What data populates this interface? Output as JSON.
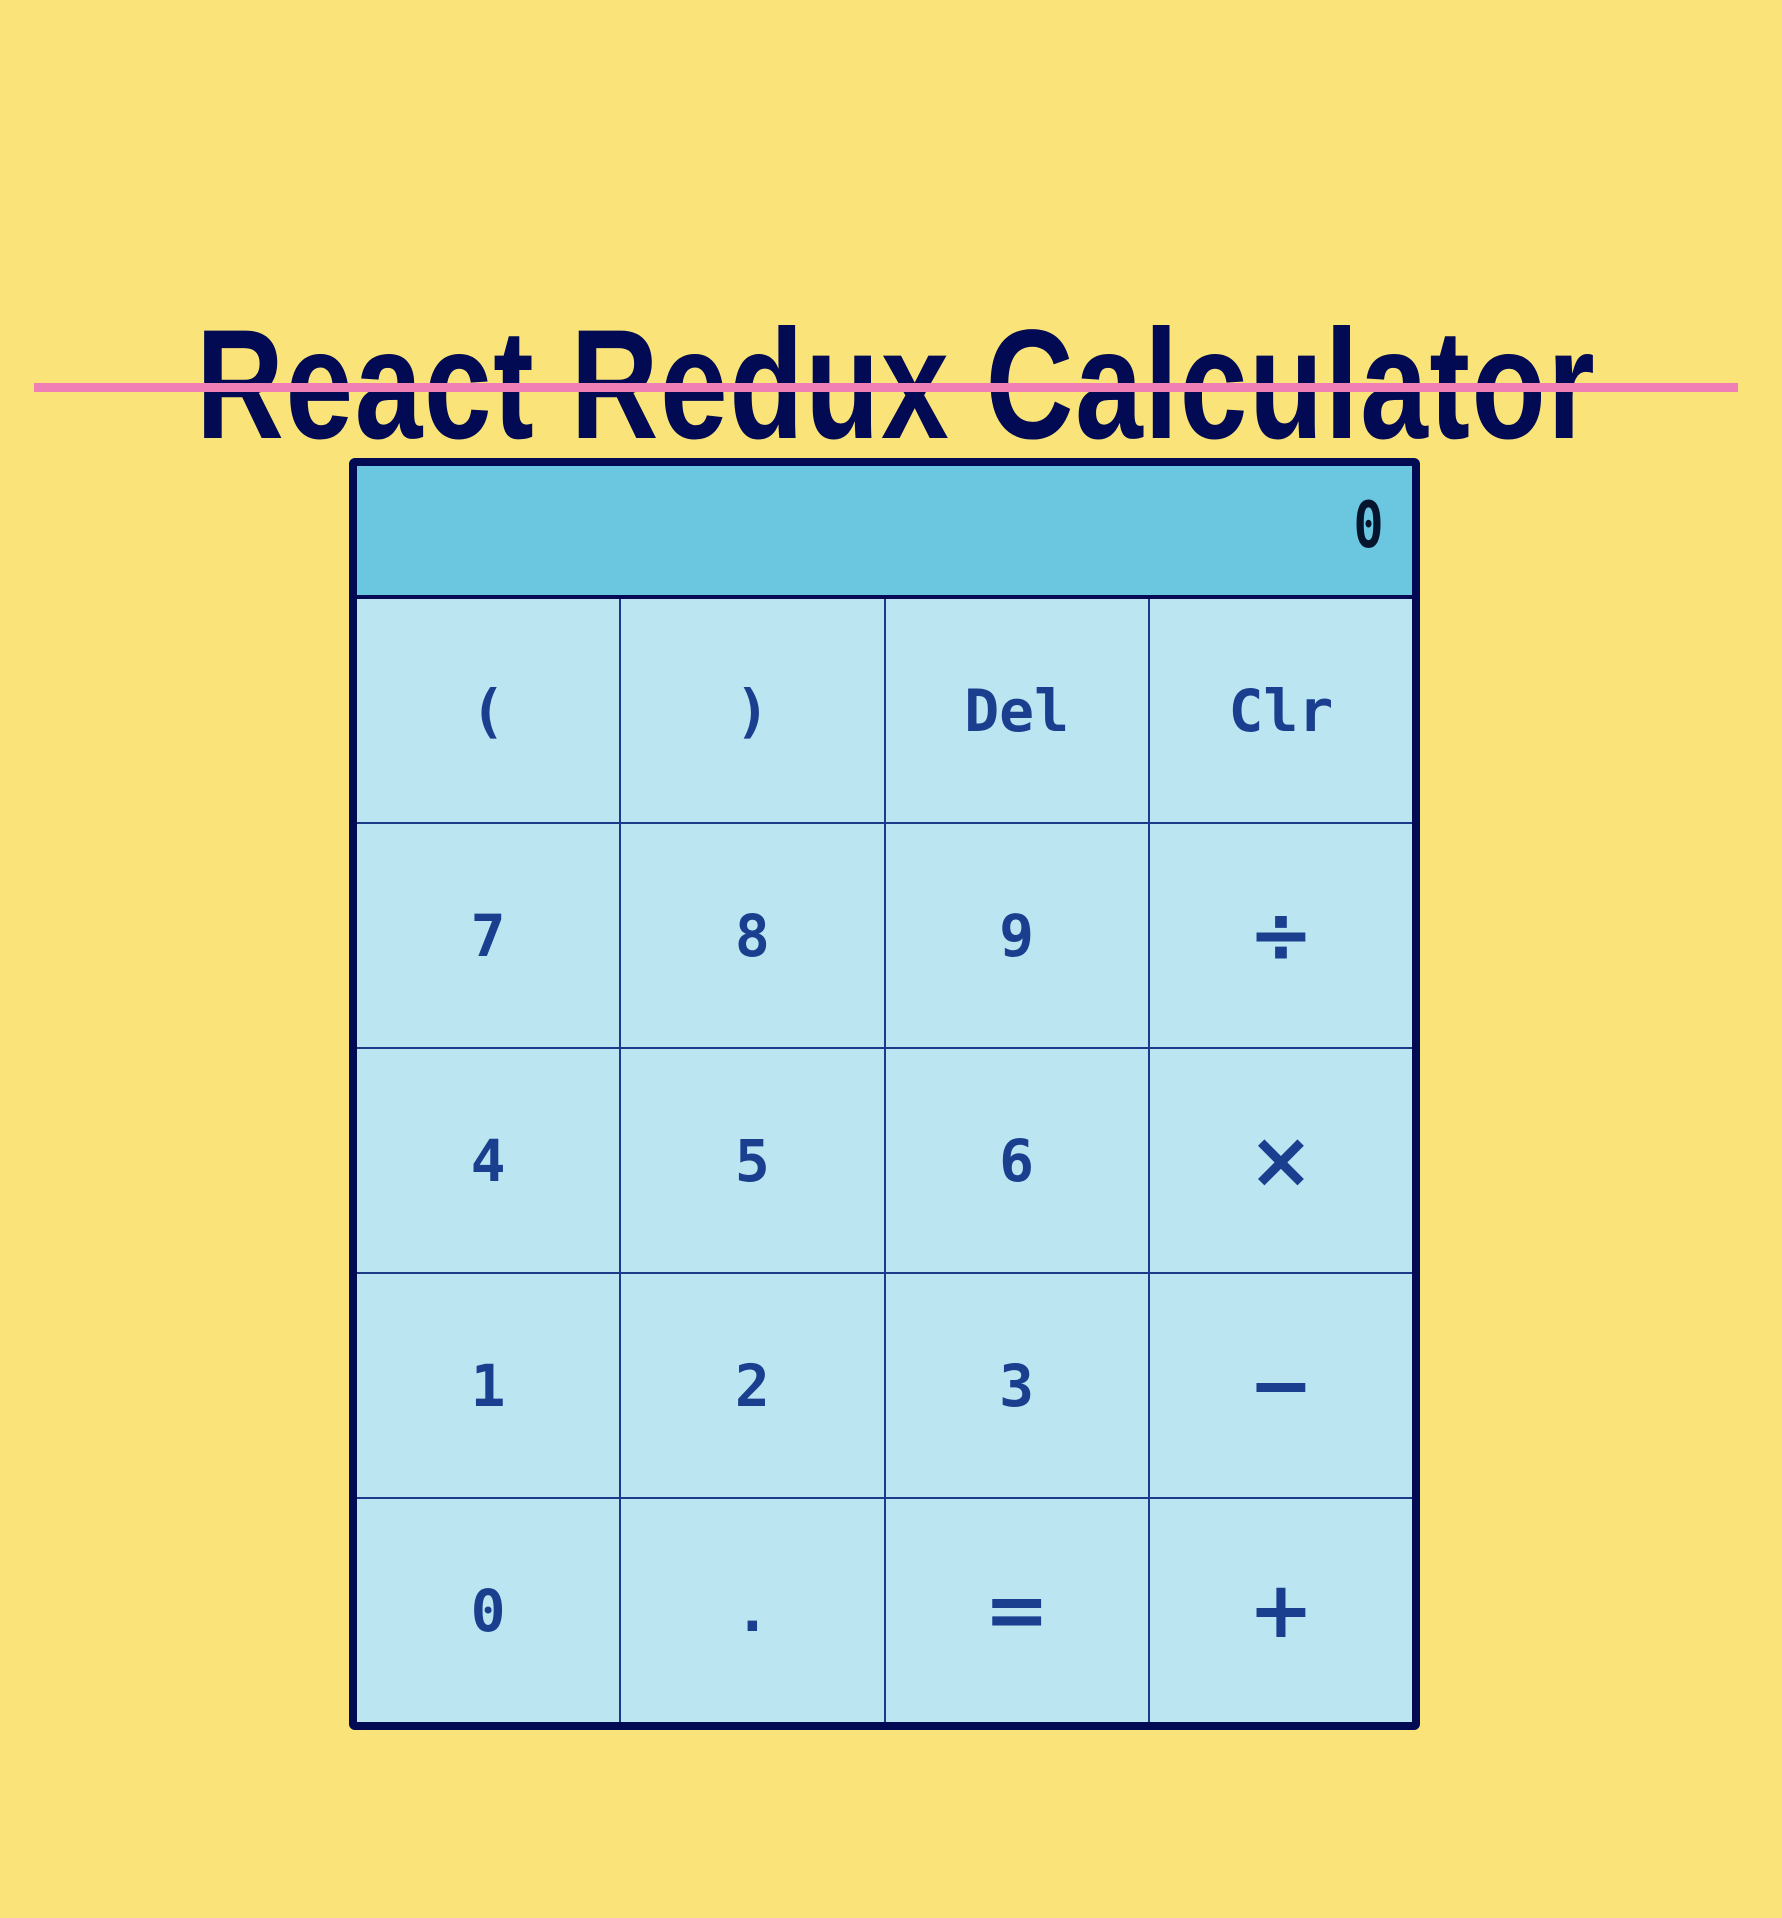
{
  "app": {
    "title": "React Redux Calculator"
  },
  "display": {
    "value": "0"
  },
  "keys": {
    "open_paren": "(",
    "close_paren": ")",
    "del": "Del",
    "clr": "Clr",
    "seven": "7",
    "eight": "8",
    "nine": "9",
    "divide": "÷",
    "four": "4",
    "five": "5",
    "six": "6",
    "multiply": "×",
    "one": "1",
    "two": "2",
    "three": "3",
    "subtract": "−",
    "zero": "0",
    "decimal": ".",
    "equals": "=",
    "add": "+"
  },
  "colors": {
    "background": "#fae479",
    "title": "#010a53",
    "rule": "#ef7fb5",
    "display_bg": "#6bc6e0",
    "key_bg": "#bce5f2",
    "key_text": "#1b3f8f",
    "frame": "#010a53"
  }
}
